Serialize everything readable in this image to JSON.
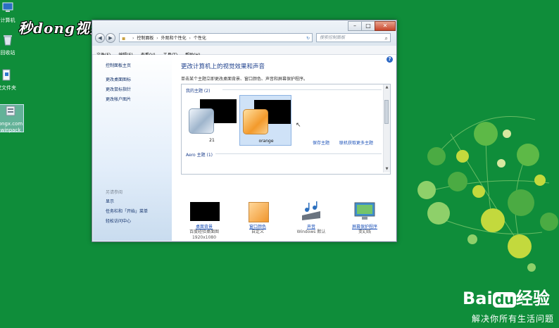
{
  "watermark": "秒dong视频",
  "desktop_icons": [
    {
      "label": "计算机"
    },
    {
      "label": "回收站"
    },
    {
      "label": "建文件夹"
    },
    {
      "label": "ongx.com\nwinpack"
    }
  ],
  "window": {
    "controls": [
      "–",
      "□",
      "✕"
    ],
    "address": [
      "控制面板",
      "外观和个性化",
      "个性化"
    ],
    "search_placeholder": "搜索控制面板",
    "menu": [
      "文件(F)",
      "编辑(E)",
      "查看(V)",
      "工具(T)",
      "帮助(H)"
    ],
    "left_links": [
      "控制面板主页",
      "更改桌面图标",
      "更改鼠标指针",
      "更改帐户图片"
    ],
    "see_also_heading": "另请参阅",
    "see_also_links": [
      "显示",
      "任务栏和「开始」菜单",
      "轻松访问中心"
    ],
    "title": "更改计算机上的视觉效果和声音",
    "description": "单击某个主题立即更改桌面背景、窗口颜色、声音和屏幕保护程序。",
    "my_themes_label": "我的主题 (2)",
    "themes": [
      {
        "name": "21",
        "selected": false
      },
      {
        "name": "orange",
        "selected": true
      }
    ],
    "save_theme": "保存主题",
    "get_more": "联机获取更多主题",
    "aero_label": "Aero 主题 (1)",
    "bottom_items": [
      {
        "label": "桌面背景",
        "sub": "百度经验桌面图1920x1080"
      },
      {
        "label": "窗口颜色",
        "sub": "自定义"
      },
      {
        "label": "声音",
        "sub": "Windows 默认"
      },
      {
        "label": "屏幕保护程序",
        "sub": "变幻线"
      }
    ]
  },
  "baidu": {
    "brand_left": "Bai",
    "brand_du": "du",
    "brand_right": "经验",
    "tagline": "解决你所有生活问题"
  }
}
